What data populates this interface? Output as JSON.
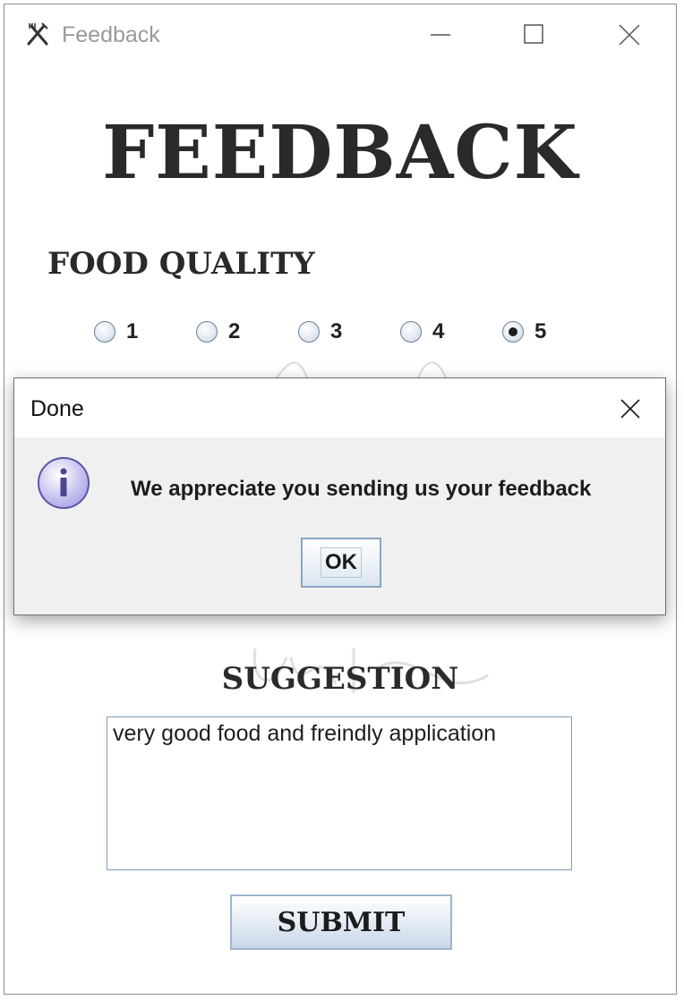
{
  "window": {
    "title": "Feedback",
    "icon": "fork-knife-icon"
  },
  "form": {
    "heading": "FEEDBACK",
    "food_quality_label": "FOOD QUALITY",
    "rating_options": [
      "1",
      "2",
      "3",
      "4",
      "5"
    ],
    "selected_rating": "5",
    "suggestion_label": "SUGGESTION",
    "suggestion_text": "very good food and freindly application",
    "submit_label": "SUBMIT"
  },
  "dialog": {
    "title": "Done",
    "icon": "info-icon",
    "message": "We appreciate you sending us your feedback",
    "ok_label": "OK"
  }
}
